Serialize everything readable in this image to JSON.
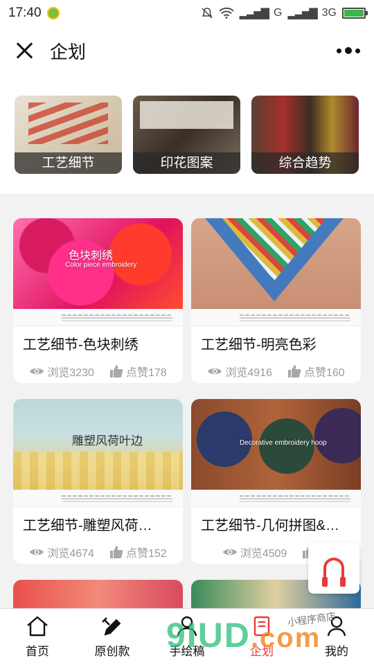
{
  "status_bar": {
    "time": "17:40",
    "network_1": "G",
    "network_2": "3G"
  },
  "header": {
    "title": "企划"
  },
  "categories": [
    {
      "label": "工艺细节"
    },
    {
      "label": "印花图案"
    },
    {
      "label": "综合趋势"
    }
  ],
  "cards": [
    {
      "title": "工艺细节-色块刺绣",
      "views": "浏览3230",
      "likes": "点赞178",
      "caption": "色块刺绣",
      "caption_en": "Color piece embroidery"
    },
    {
      "title": "工艺细节-明亮色彩",
      "views": "浏览4916",
      "likes": "点赞160"
    },
    {
      "title": "工艺细节-雕塑风荷…",
      "views": "浏览4674",
      "likes": "点赞152",
      "caption": "雕塑风荷叶边"
    },
    {
      "title": "工艺细节-几何拼图&…",
      "views": "浏览4509",
      "likes": "点",
      "caption_en": "Decorative embroidery hoop"
    }
  ],
  "bottom_nav": [
    {
      "label": "首页",
      "icon": "home-icon"
    },
    {
      "label": "原创款",
      "icon": "pencil-ruler-icon"
    },
    {
      "label": "手绘稿",
      "icon": "user-icon"
    },
    {
      "label": "企划",
      "icon": "book-icon"
    },
    {
      "label": "我的",
      "icon": "profile-icon"
    }
  ],
  "watermark": {
    "text": "9IUD",
    "suffix": ".com",
    "handwritten": "小程序商店"
  },
  "colors": {
    "accent_red": "#e83a3a",
    "battery_green": "#3cb54a"
  }
}
